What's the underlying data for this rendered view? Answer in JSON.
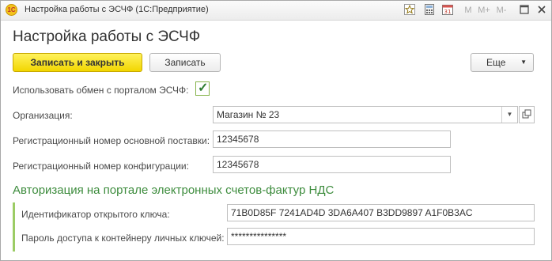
{
  "window": {
    "title": "Настройка работы с ЭСЧФ  (1С:Предприятие)",
    "app_badge": "1С",
    "controls": {
      "m": "M",
      "m_plus": "M+",
      "m_minus": "M-"
    }
  },
  "form": {
    "heading": "Настройка работы с ЭСЧФ",
    "buttons": {
      "write_close": "Записать и закрыть",
      "write": "Записать",
      "more": "Еще"
    },
    "use_exchange_label": "Использовать обмен с порталом ЭСЧФ:",
    "use_exchange_checked": true,
    "organization_label": "Организация:",
    "organization_value": "Магазин № 23",
    "reg_supply_label": "Регистрационный номер основной поставки:",
    "reg_supply_value": "12345678",
    "reg_config_label": "Регистрационный номер конфигурации:",
    "reg_config_value": "12345678",
    "auth_section_title": "Авторизация на портале электронных счетов-фактур НДС",
    "key_id_label": "Идентификатор открытого ключа:",
    "key_id_value": "71B0D85F 7241AD4D 3DA6A407 B3DD9897 A1F0B3AC",
    "container_password_label": "Пароль доступа к контейнеру личных ключей:",
    "container_password_value": "***************"
  },
  "colors": {
    "primary_button": "#f2d600",
    "section_title": "#3d8c3d",
    "group_bar": "#9ccc65"
  }
}
